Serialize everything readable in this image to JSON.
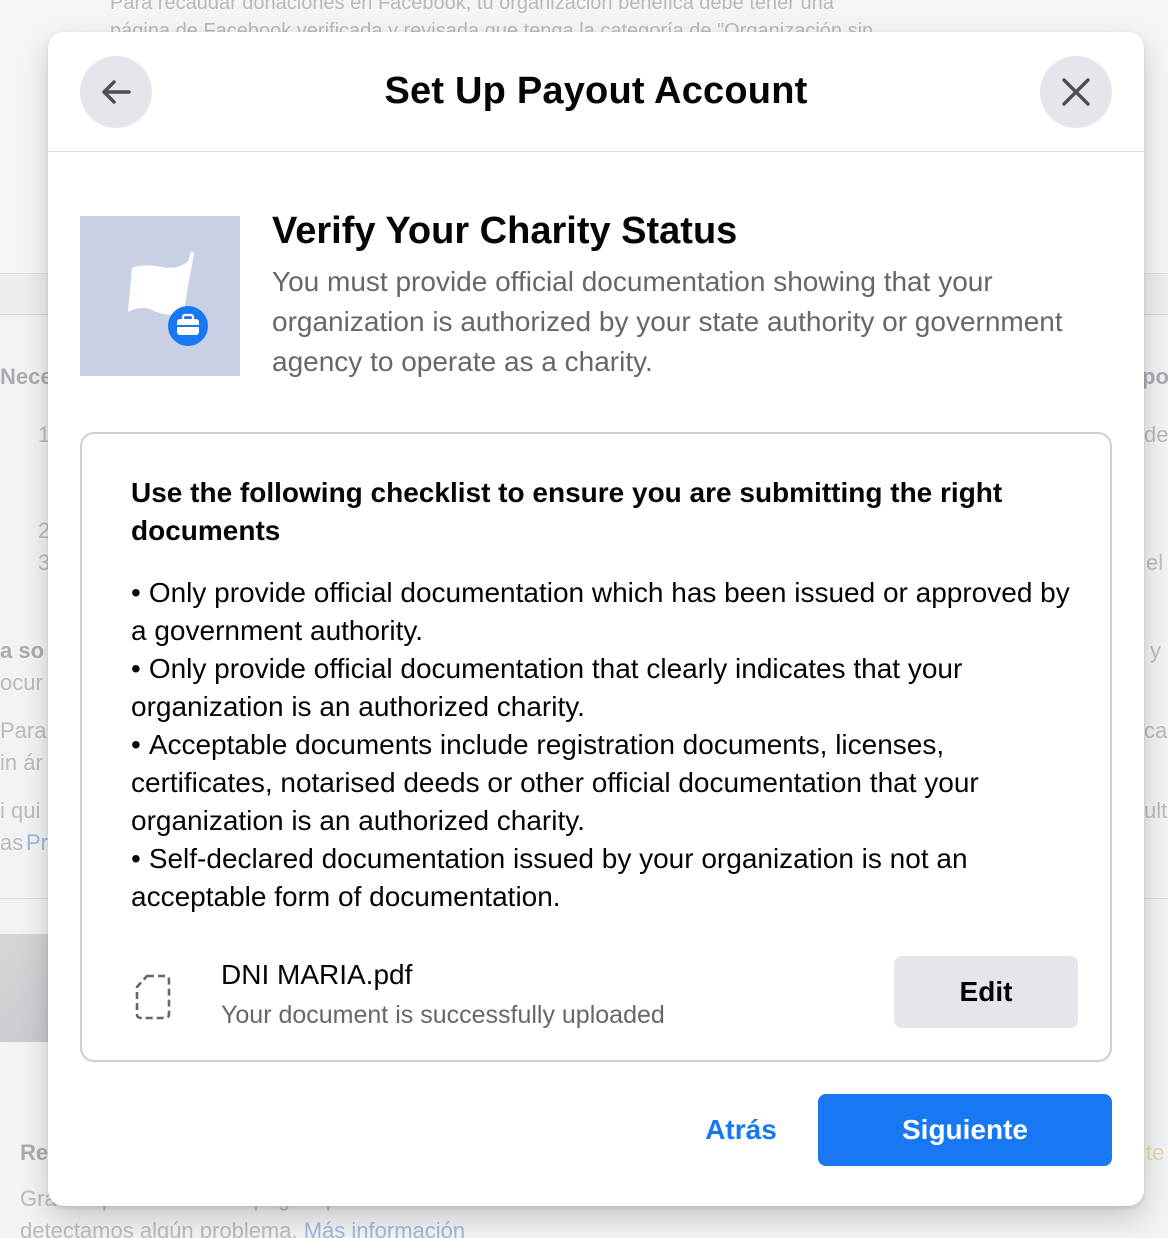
{
  "background": {
    "top_lines": [
      "Para recaudar donaciones en Facebook, tu organización benéfica debe tener una",
      "página de Facebook verificada y revisada que tenga la categoría de \"Organización sin"
    ],
    "left_fragments": [
      "Nece",
      "1",
      "2",
      "3",
      "a so",
      "ocur",
      "Para c",
      "in ár",
      "i qui",
      "as ",
      "Pr",
      "Re"
    ],
    "right_fragments": [
      "po",
      "de",
      "el",
      "y",
      "ca",
      "ult",
      "te"
    ],
    "bottom_lines": [
      "Gracias por enviar esta página para su revisión. Te enviaremos un correo electrónico si",
      "detectamos algún problema. "
    ],
    "bottom_link": "Más información"
  },
  "modal": {
    "title": "Set Up Payout Account",
    "back_icon": "arrow-left-icon",
    "close_icon": "close-icon",
    "hero": {
      "icon": "white-flag-briefcase-icon",
      "title": "Verify Your Charity Status",
      "description": "You must provide official documentation showing that your organization is authorized by your state authority or government agency to operate as a charity."
    },
    "checklist": {
      "heading": "Use the following checklist to ensure you are submitting the right documents",
      "bullet": "•",
      "items": [
        "Only provide official documentation which has been issued or approved by a government authority.",
        "Only provide official documentation that clearly indicates that your organization is an authorized charity.",
        "Acceptable documents include registration documents, licenses, certificates, notarised deeds or other official documentation that your organization is an authorized charity.",
        "Self-declared documentation issued by your organization is not an acceptable form of documentation."
      ]
    },
    "file": {
      "icon": "document-icon",
      "name": "DNI MARIA.pdf",
      "status": "Your document is successfully uploaded",
      "edit_label": "Edit"
    },
    "footer": {
      "back_label": "Atrás",
      "next_label": "Siguiente"
    }
  },
  "colors": {
    "accent": "#1877f2",
    "secondary_button": "#e4e6eb",
    "hero_illustration_bg": "#c9d0e3",
    "muted_text": "#65676b"
  }
}
